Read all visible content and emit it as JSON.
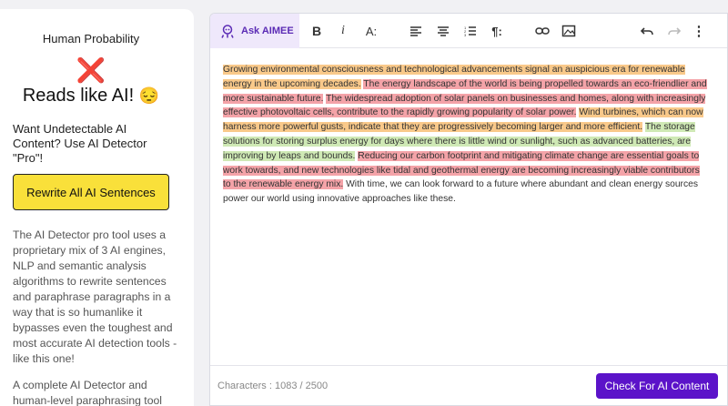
{
  "sidebar": {
    "title": "Human Probability",
    "result_mark": "❌",
    "result_text": "Reads like AI!",
    "result_emoji": "😔",
    "promo": "Want Undetectable AI Content? Use AI Detector \"Pro\"!",
    "rewrite_label": "Rewrite All AI Sentences",
    "description": "The AI Detector pro tool uses a proprietary mix of 3 AI engines, NLP and semantic analysis algorithms to rewrite sentences and paraphrase paragraphs in a way that is so humanlike it bypasses even the toughest and most accurate AI detection tools - like this one!",
    "description2": "A complete AI Detector and human-level paraphrasing tool with everything you need"
  },
  "toolbar": {
    "ask_label": "Ask AIMEE",
    "italic_glyph": "i",
    "bold_glyph": "B",
    "fontsize_glyph": "A:",
    "paragraph_glyph": "¶:",
    "more_glyph": "⋮"
  },
  "editor": {
    "sentences": [
      {
        "text": "Growing environmental consciousness and technological advancements signal an auspicious era for renewable energy in the upcoming decades.",
        "highlight": "orange"
      },
      {
        "text": "The energy landscape of the world is being propelled towards an eco-friendlier and more sustainable future.",
        "highlight": "red"
      },
      {
        "text": "The widespread adoption of solar panels on businesses and homes, along with increasingly effective photovoltaic cells, contribute to the rapidly growing popularity of solar power.",
        "highlight": "red"
      },
      {
        "text": "Wind turbines, which can now harness more powerful gusts, indicate that they are progressively becoming larger and more efficient.",
        "highlight": "orange"
      },
      {
        "text": "The storage solutions for storing surplus energy for days where there is little wind or sunlight, such as advanced batteries, are improving by leaps and bounds.",
        "highlight": "green"
      },
      {
        "text": "Reducing our carbon footprint and mitigating climate change are essential goals to work towards, and new technologies like tidal and geothermal energy are becoming increasingly viable contributors to the renewable energy mix.",
        "highlight": "red"
      },
      {
        "text": "With time, we can look forward to a future where abundant and clean energy sources power our world using innovative approaches like these.",
        "highlight": "none"
      }
    ],
    "colors": {
      "orange": "#f9c98a",
      "red": "#f4a3a8",
      "green": "#cfe9b5"
    }
  },
  "footer": {
    "chars_label": "Characters : 1083  / 2500",
    "check_label": "Check For AI Content"
  }
}
